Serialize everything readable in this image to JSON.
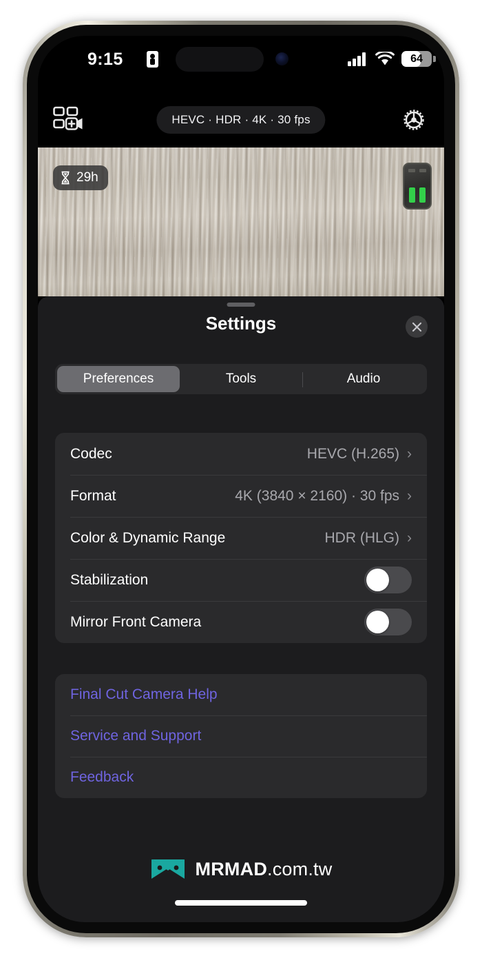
{
  "status_bar": {
    "time": "9:15",
    "lock_icon": "lock-portrait-icon",
    "cellular_icon": "cellular-bars-icon",
    "wifi_icon": "wifi-icon",
    "battery_percent": "64",
    "battery_level": 64
  },
  "camera_topbar": {
    "multicam_icon": "multicam-add-video-icon",
    "format_pill": "HEVC · HDR · 4K · 30 fps",
    "settings_icon": "gear-icon"
  },
  "preview": {
    "timer_badge": {
      "icon": "hourglass-icon",
      "label": "29h"
    },
    "charger_object": "battery-charger-object"
  },
  "sheet": {
    "title": "Settings",
    "grabber": "sheet-grabber",
    "close_icon": "close-icon"
  },
  "tabs": [
    {
      "label": "Preferences",
      "selected": true
    },
    {
      "label": "Tools",
      "selected": false
    },
    {
      "label": "Audio",
      "selected": false
    }
  ],
  "preferences_rows": [
    {
      "type": "value",
      "label": "Codec",
      "value": "HEVC (H.265)",
      "chevron": "›"
    },
    {
      "type": "value",
      "label": "Format",
      "value": "4K (3840 × 2160) · 30 fps",
      "chevron": "›"
    },
    {
      "type": "value",
      "label": "Color & Dynamic Range",
      "value": "HDR (HLG)",
      "chevron": "›"
    },
    {
      "type": "toggle",
      "label": "Stabilization",
      "on": false
    },
    {
      "type": "toggle",
      "label": "Mirror Front Camera",
      "on": false
    }
  ],
  "link_rows": [
    {
      "label": "Final Cut Camera Help"
    },
    {
      "label": "Service and Support"
    },
    {
      "label": "Feedback"
    }
  ],
  "watermark": {
    "logo": "mrmad-bowtie-logo",
    "brand": "MRMAD",
    "tld": ".com.tw"
  },
  "colors": {
    "sheet_background": "#1c1c1e",
    "group_background": "#2a2a2c",
    "link_purple": "#6f64e0",
    "selected_segment": "#6c6c70",
    "value_gray": "#a8a8ad",
    "logo_teal": "#1aa8a0",
    "charger_led_green": "#33d04a"
  }
}
